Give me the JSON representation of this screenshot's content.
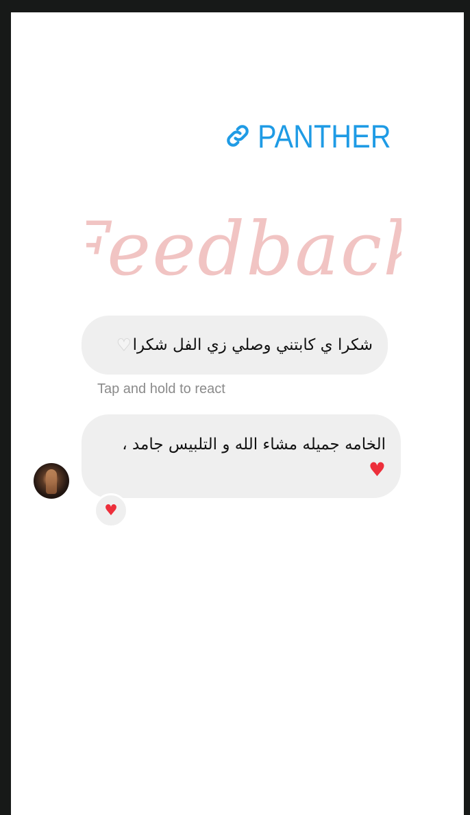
{
  "link_sticker": {
    "icon": "link-icon",
    "text": "PANTHER",
    "color": "#1f9be5"
  },
  "title": {
    "text": "Feedback",
    "color": "#f1c4c3"
  },
  "messages": [
    {
      "text": "شكرا ي كابتني وصلي زي الفل شكرا",
      "emoji": "white-heart"
    },
    {
      "text": "الخامه جميله مشاء الله و التلبيس جامد ،",
      "emoji": "red-heart",
      "reaction": "red-heart"
    }
  ],
  "hint": "Tap and hold to react",
  "colors": {
    "frame": "#171918",
    "bubble": "#efefef",
    "heart": "#ed2f3b"
  }
}
